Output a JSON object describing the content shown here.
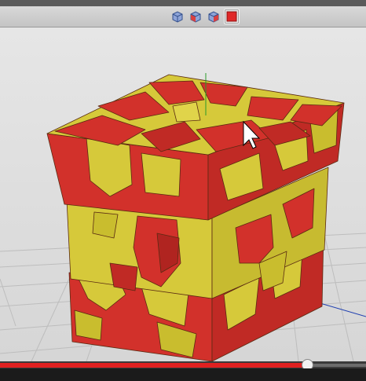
{
  "toolbar": {
    "view_buttons": [
      {
        "name": "perspective-view",
        "icon": "cube-outline-icon",
        "color": "#6a86c8",
        "active": false
      },
      {
        "name": "front-view",
        "icon": "cube-front-icon",
        "color": "#6a86c8",
        "active": false
      },
      {
        "name": "side-view",
        "icon": "cube-side-icon",
        "color": "#6a86c8",
        "active": false
      },
      {
        "name": "shaded-view",
        "icon": "cube-solid-red-icon",
        "color": "#e02828",
        "active": true
      }
    ]
  },
  "model": {
    "primary_color": "#d2312b",
    "secondary_color": "#d6c93a",
    "grid_color": "#bdbdbd",
    "axis_color": "#1f3fb0"
  },
  "player": {
    "progress": 0.84,
    "fill_color": "#e02020"
  }
}
